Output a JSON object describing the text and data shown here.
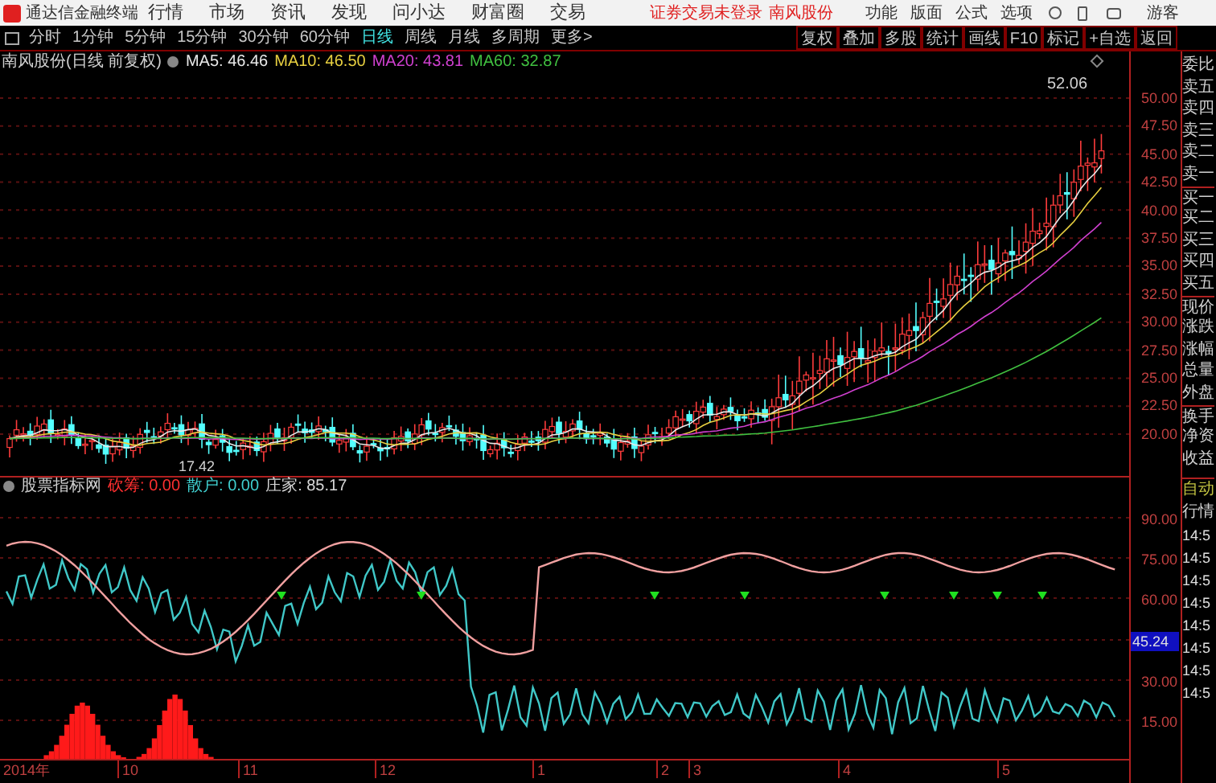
{
  "app": {
    "name": "通达信金融终端"
  },
  "menu": [
    "行情",
    "市场",
    "资讯",
    "发现",
    "问小达",
    "财富圈",
    "交易"
  ],
  "login_status": "证券交易未登录",
  "stock_link": "南风股份",
  "right_menu": [
    "功能",
    "版面",
    "公式",
    "选项"
  ],
  "user": "游客",
  "periods": [
    {
      "label": "分时",
      "selected": false
    },
    {
      "label": "1分钟",
      "selected": false
    },
    {
      "label": "5分钟",
      "selected": false
    },
    {
      "label": "15分钟",
      "selected": false
    },
    {
      "label": "30分钟",
      "selected": false
    },
    {
      "label": "60分钟",
      "selected": false
    },
    {
      "label": "日线",
      "selected": true
    },
    {
      "label": "周线",
      "selected": false
    },
    {
      "label": "月线",
      "selected": false
    },
    {
      "label": "多周期",
      "selected": false
    },
    {
      "label": "更多>",
      "selected": false
    }
  ],
  "tools": [
    "复权",
    "叠加",
    "多股",
    "统计",
    "画线",
    "F10",
    "标记",
    "+自选",
    "返回"
  ],
  "legend": {
    "title": "南风股份(日线 前复权)",
    "ma": [
      {
        "label": "MA5: 46.46",
        "color": "#e8e8e8"
      },
      {
        "label": "MA10: 46.50",
        "color": "#e8d040"
      },
      {
        "label": "MA20: 43.81",
        "color": "#d040d0"
      },
      {
        "label": "MA60: 32.87",
        "color": "#40c040"
      }
    ]
  },
  "price_axis": [
    "50.00",
    "47.50",
    "45.00",
    "42.50",
    "40.00",
    "37.50",
    "35.00",
    "32.50",
    "30.00",
    "27.50",
    "25.00",
    "22.50",
    "20.00"
  ],
  "high_label": "52.06",
  "low_label": "17.42",
  "quote_labels": [
    "委比",
    "卖五",
    "卖四",
    "卖三",
    "卖二",
    "卖一",
    "买一",
    "买二",
    "买三",
    "买四",
    "买五",
    "现价",
    "涨跌",
    "涨幅",
    "总量",
    "外盘",
    "换手",
    "净资",
    "收益"
  ],
  "indicator": {
    "name": "股票指标网",
    "values": [
      {
        "label": "砍筹:",
        "value": "0.00",
        "color": "#ff3030"
      },
      {
        "label": "散户:",
        "value": "0.00",
        "color": "#40d0d0"
      },
      {
        "label": "庄家:",
        "value": "85.17",
        "color": "#d8d8d8"
      }
    ],
    "axis": [
      "90.00",
      "75.00",
      "60.00",
      "45.24",
      "30.00",
      "15.00"
    ]
  },
  "side_status": "自动",
  "side_header": "行情",
  "times": [
    "14:5",
    "14:5",
    "14:5",
    "14:5",
    "14:5",
    "14:5",
    "14:5",
    "14:5"
  ],
  "dates": [
    "2014年",
    "10",
    "11",
    "12",
    "1",
    "2",
    "3",
    "4",
    "5"
  ]
}
